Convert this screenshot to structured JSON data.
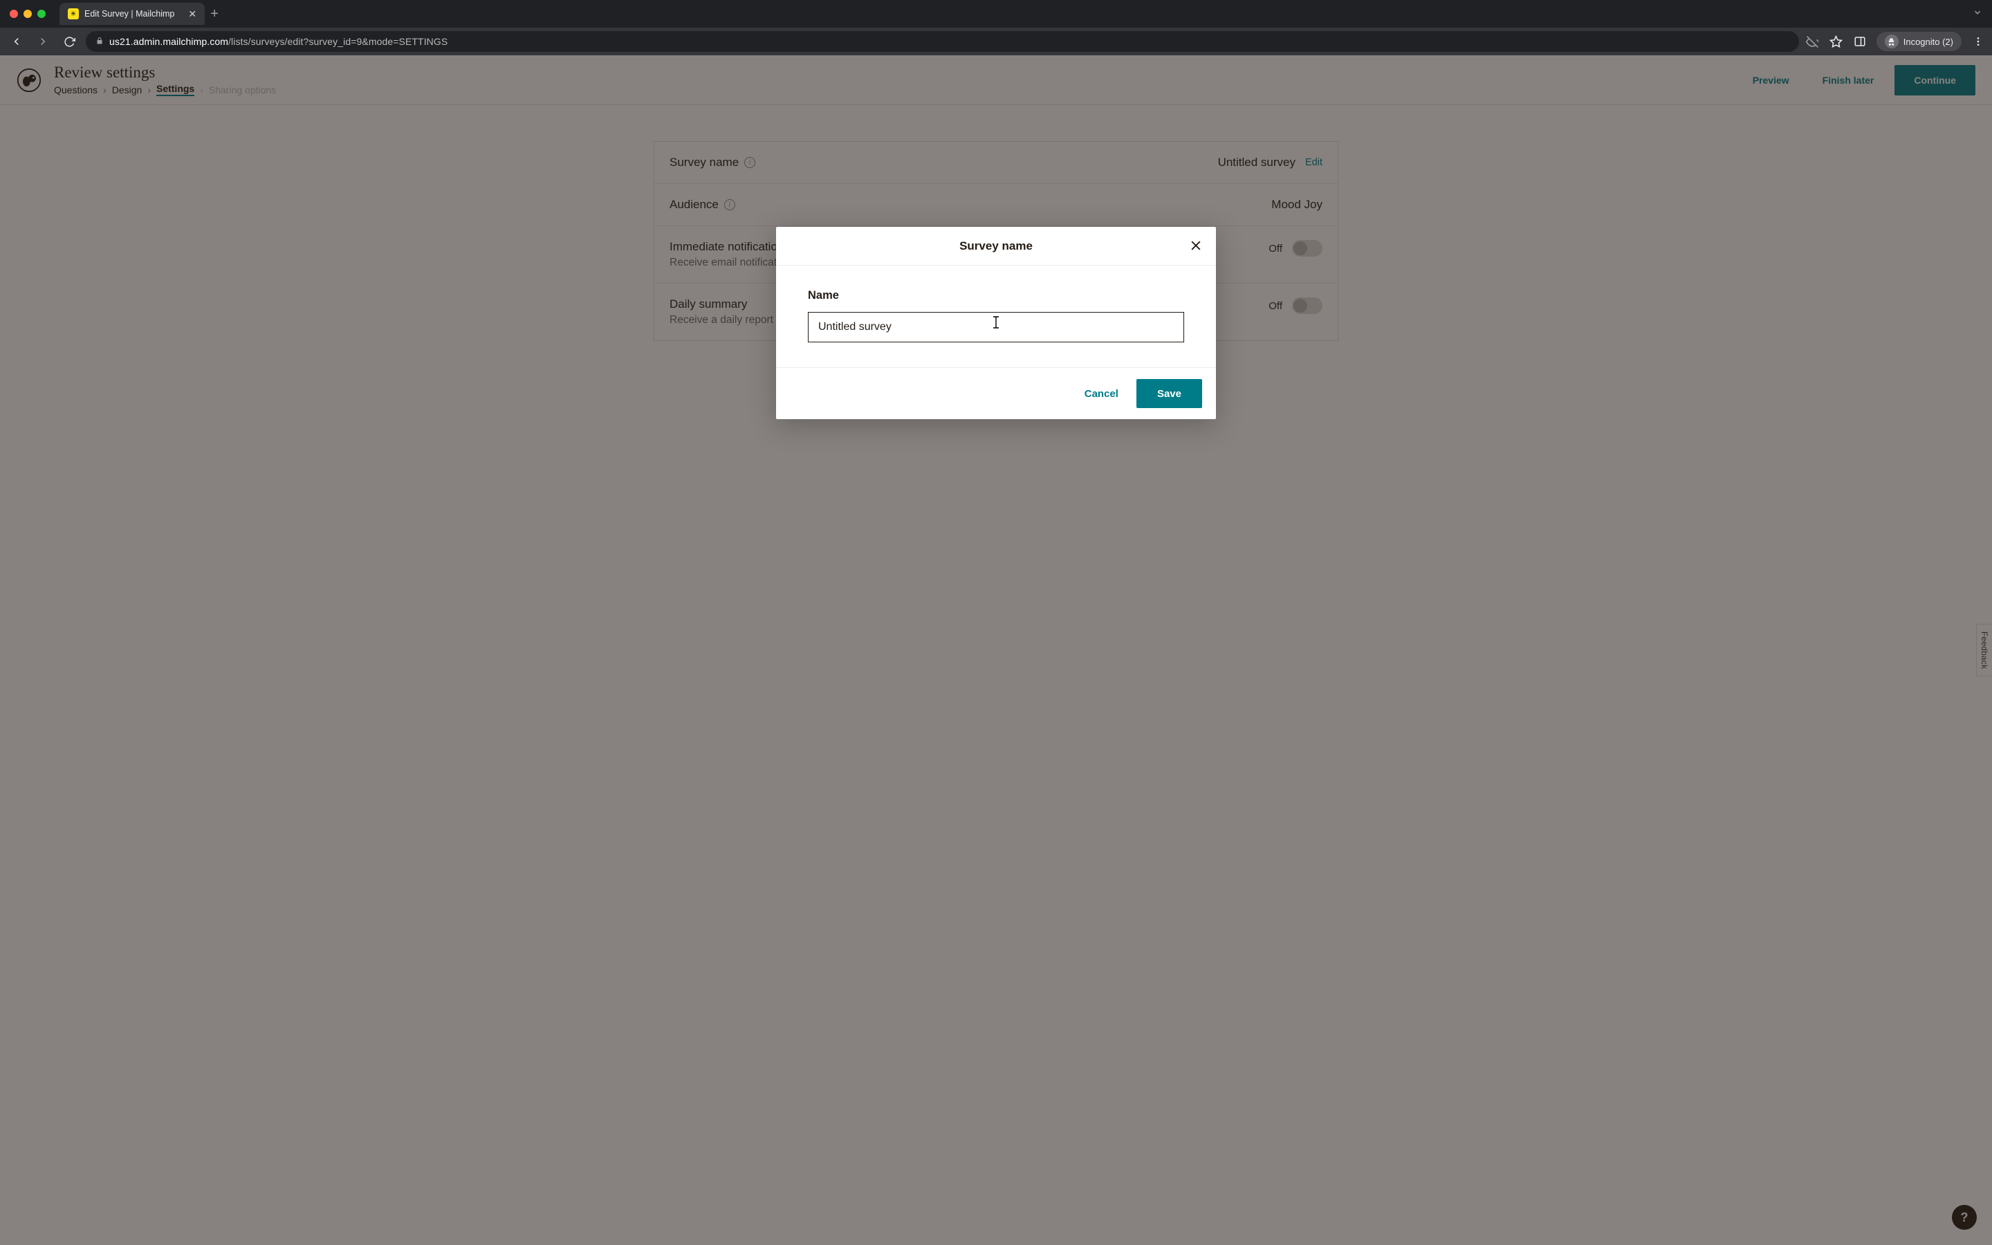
{
  "browser": {
    "tab_title": "Edit Survey | Mailchimp",
    "url_host": "us21.admin.mailchimp.com",
    "url_path": "/lists/surveys/edit?survey_id=9&mode=SETTINGS",
    "incognito_label": "Incognito (2)"
  },
  "header": {
    "page_title": "Review settings",
    "crumbs": [
      "Questions",
      "Design",
      "Settings",
      "Sharing options"
    ],
    "active_crumb_index": 2,
    "preview_label": "Preview",
    "finish_later_label": "Finish later",
    "continue_label": "Continue"
  },
  "settings": {
    "survey_name": {
      "label": "Survey name",
      "value": "Untitled survey",
      "edit_label": "Edit"
    },
    "audience": {
      "label": "Audience",
      "value": "Mood Joy"
    },
    "immediate": {
      "label": "Immediate notification",
      "sub": "Receive email notificat",
      "state_label": "Off"
    },
    "daily": {
      "label": "Daily summary",
      "sub": "Receive a daily report",
      "state_label": "Off"
    }
  },
  "modal": {
    "title": "Survey name",
    "field_label": "Name",
    "input_value": "Untitled survey",
    "cancel_label": "Cancel",
    "save_label": "Save"
  },
  "misc": {
    "feedback_label": "Feedback",
    "help_label": "?"
  }
}
